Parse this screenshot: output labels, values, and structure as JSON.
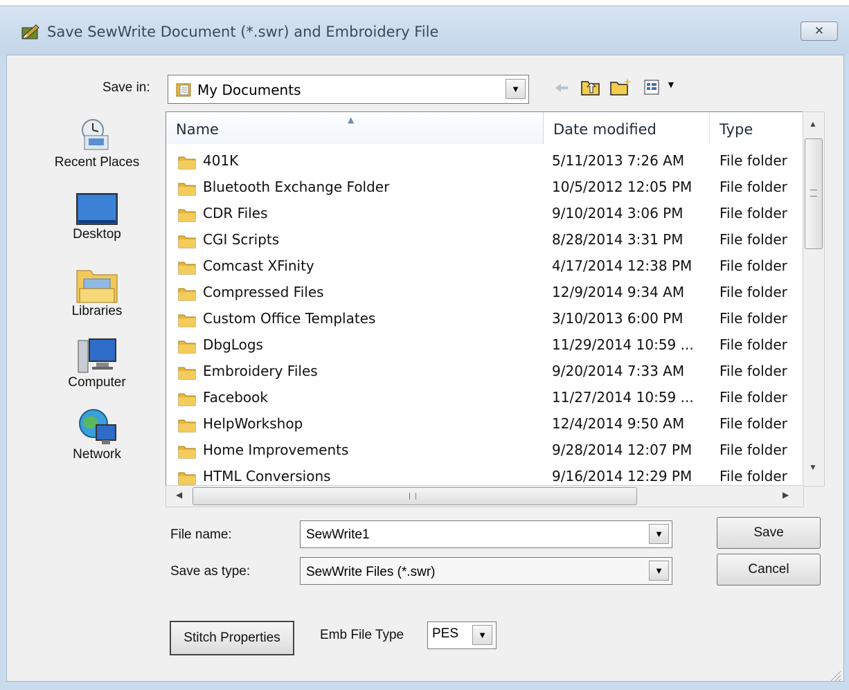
{
  "window": {
    "title": "Save SewWrite Document (*.swr) and Embroidery File",
    "close_glyph": "✕"
  },
  "toolbar": {
    "save_in_label": "Save in:",
    "save_in_value": "My Documents",
    "back_icon": "back-arrow-icon",
    "up_icon": "up-folder-icon",
    "new_folder_icon": "new-folder-icon",
    "views_icon": "views-menu-icon"
  },
  "places": [
    {
      "label": "Recent Places",
      "icon": "recent-places-icon"
    },
    {
      "label": "Desktop",
      "icon": "desktop-icon"
    },
    {
      "label": "Libraries",
      "icon": "libraries-icon"
    },
    {
      "label": "Computer",
      "icon": "computer-icon"
    },
    {
      "label": "Network",
      "icon": "network-icon"
    }
  ],
  "list": {
    "columns": [
      "Name",
      "Date modified",
      "Type"
    ],
    "rows": [
      {
        "name": "401K",
        "date": "5/11/2013 7:26 AM",
        "type": "File folder"
      },
      {
        "name": "Bluetooth Exchange Folder",
        "date": "10/5/2012 12:05 PM",
        "type": "File folder"
      },
      {
        "name": "CDR Files",
        "date": "9/10/2014 3:06 PM",
        "type": "File folder"
      },
      {
        "name": "CGI Scripts",
        "date": "8/28/2014 3:31 PM",
        "type": "File folder"
      },
      {
        "name": "Comcast XFinity",
        "date": "4/17/2014 12:38 PM",
        "type": "File folder"
      },
      {
        "name": "Compressed Files",
        "date": "12/9/2014 9:34 AM",
        "type": "File folder"
      },
      {
        "name": "Custom Office Templates",
        "date": "3/10/2013 6:00 PM",
        "type": "File folder"
      },
      {
        "name": "DbgLogs",
        "date": "11/29/2014 10:59 ...",
        "type": "File folder"
      },
      {
        "name": "Embroidery Files",
        "date": "9/20/2014 7:33 AM",
        "type": "File folder"
      },
      {
        "name": "Facebook",
        "date": "11/27/2014 10:59 ...",
        "type": "File folder"
      },
      {
        "name": "HelpWorkshop",
        "date": "12/4/2014 9:50 AM",
        "type": "File folder"
      },
      {
        "name": "Home Improvements",
        "date": "9/28/2014 12:07 PM",
        "type": "File folder"
      },
      {
        "name": "HTML Conversions",
        "date": "9/16/2014 12:29 PM",
        "type": "File folder"
      }
    ]
  },
  "form": {
    "file_name_label": "File name:",
    "file_name_value": "SewWrite1",
    "save_type_label": "Save as type:",
    "save_type_value": "SewWrite Files (*.swr)",
    "save_button": "Save",
    "cancel_button": "Cancel",
    "stitch_button": "Stitch Properties",
    "emb_label": "Emb File Type",
    "emb_value": "PES"
  },
  "colors": {
    "folder": "#e8b73a",
    "title_bg": "#c9dcee",
    "selection_border": "#7da2ce"
  }
}
